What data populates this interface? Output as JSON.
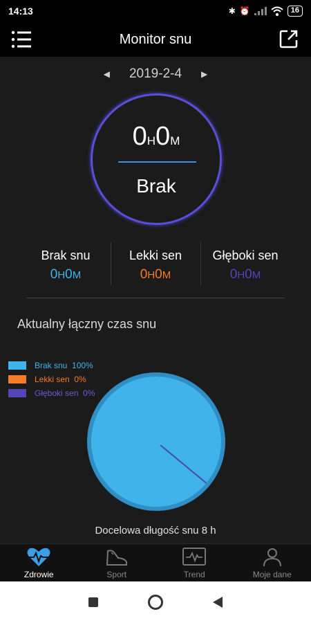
{
  "status_bar": {
    "time": "14:13",
    "battery": "16"
  },
  "header": {
    "title": "Monitor snu"
  },
  "date": {
    "value": "2019-2-4"
  },
  "summary": {
    "hours": "0",
    "hours_unit": "H",
    "minutes": "0",
    "minutes_unit": "M",
    "status": "Brak"
  },
  "stats": [
    {
      "label": "Brak snu",
      "hours": "0",
      "minutes": "0",
      "color": "#3fb3ea"
    },
    {
      "label": "Lekki sen",
      "hours": "0",
      "minutes": "0",
      "color": "#f47d2a"
    },
    {
      "label": "Głęboki sen",
      "hours": "0",
      "minutes": "0",
      "color": "#5546b8"
    }
  ],
  "units": {
    "h": "H",
    "m": "M"
  },
  "section_title": "Aktualny łączny czas snu",
  "legend": [
    {
      "label": "Brak snu",
      "percent": "100%",
      "color": "#3fb3ea"
    },
    {
      "label": "Lekki sen",
      "percent": "0%",
      "color": "#f47d2a"
    },
    {
      "label": "Głęboki sen",
      "percent": "0%",
      "color": "#5546b8"
    }
  ],
  "chart_data": {
    "type": "pie",
    "categories": [
      "Brak snu",
      "Lekki sen",
      "Głęboki sen"
    ],
    "values": [
      100,
      0,
      0
    ],
    "colors": [
      "#3fb3ea",
      "#f47d2a",
      "#5546b8"
    ]
  },
  "goal": "Docelowa długość snu 8 h",
  "nav": [
    {
      "label": "Zdrowie",
      "icon": "heart-pulse-icon",
      "active": true
    },
    {
      "label": "Sport",
      "icon": "shoe-icon",
      "active": false
    },
    {
      "label": "Trend",
      "icon": "trend-chart-icon",
      "active": false
    },
    {
      "label": "Moje dane",
      "icon": "person-icon",
      "active": false
    }
  ],
  "accent_color": "#3aa0e6"
}
